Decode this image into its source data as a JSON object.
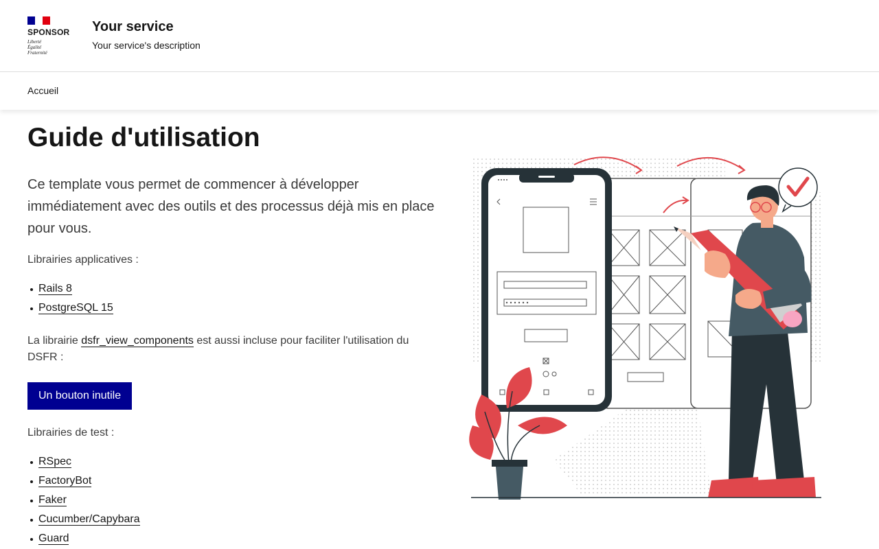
{
  "header": {
    "logo_name": "SPONSOR",
    "motto": [
      "Liberté",
      "Égalité",
      "Fraternité"
    ],
    "service_title": "Your service",
    "service_description": "Your service's description"
  },
  "nav": {
    "items": [
      {
        "label": "Accueil"
      }
    ]
  },
  "main": {
    "title": "Guide d'utilisation",
    "lead": "Ce template vous permet de commencer à développer immédiatement avec des outils et des processus déjà mis en place pour vous.",
    "app_libs_heading": "Librairies applicatives :",
    "app_libs": [
      "Rails 8",
      "PostgreSQL 15"
    ],
    "dsfr_text_before": "La librairie ",
    "dsfr_link": "dsfr_view_components",
    "dsfr_text_after": " est aussi incluse pour faciliter l'utilisation du DSFR :",
    "button_label": "Un bouton inutile",
    "test_libs_heading": "Librairies de test :",
    "test_libs": [
      "RSpec",
      "FactoryBot",
      "Faker",
      "Cucumber/Capybara",
      "Guard"
    ]
  },
  "colors": {
    "primary": "#000091",
    "marianne_red": "#e1000f",
    "illustration_red": "#e0474c",
    "illustration_dark": "#263238"
  },
  "icons": [
    "marianne-flag-icon",
    "check-mark-icon",
    "pencil-icon",
    "plant-icon"
  ]
}
